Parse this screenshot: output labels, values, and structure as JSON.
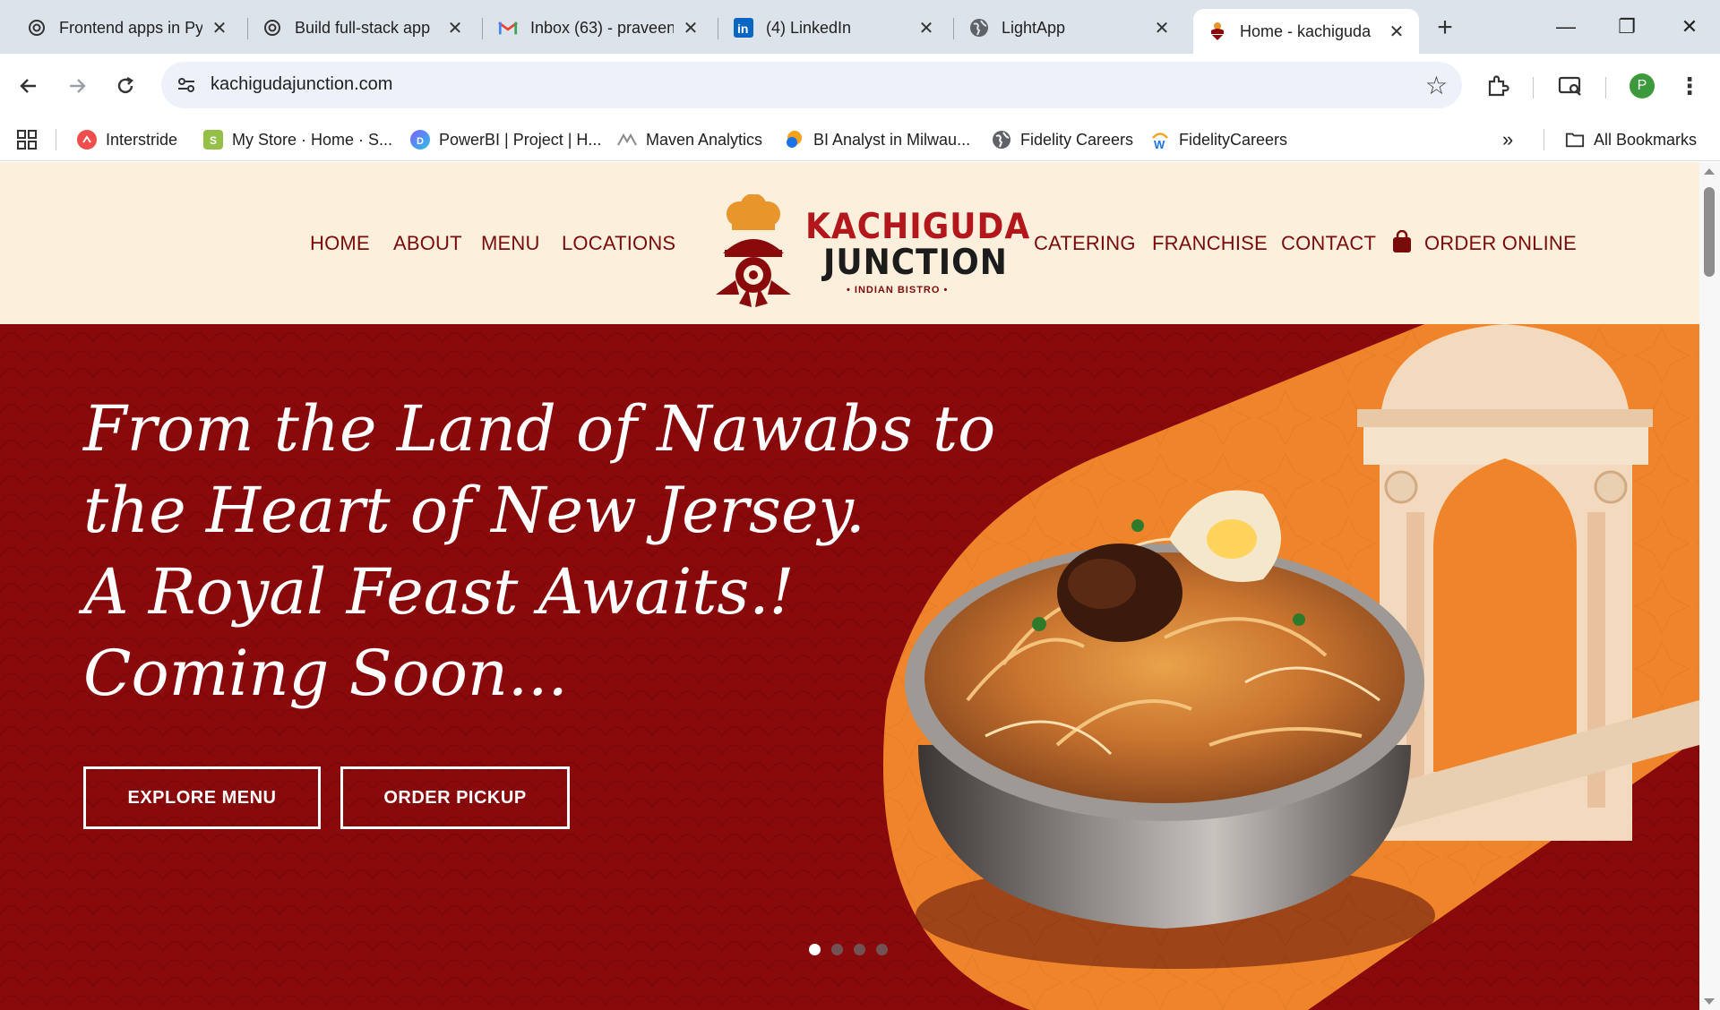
{
  "browser": {
    "tabs": [
      {
        "title": "Frontend apps in Py",
        "icon": "openai-icon",
        "active": false
      },
      {
        "title": "Build full-stack app",
        "icon": "openai-icon",
        "active": false
      },
      {
        "title": "Inbox (63) - praveen",
        "icon": "gmail-icon",
        "active": false
      },
      {
        "title": "(4) LinkedIn",
        "icon": "linkedin-icon",
        "active": false
      },
      {
        "title": "LightApp",
        "icon": "globe-icon",
        "active": false
      },
      {
        "title": "Home - kachiguda",
        "icon": "kachiguda-icon",
        "active": true
      }
    ],
    "new_tab": "+",
    "window_controls": {
      "minimize": "—",
      "restore": "❐",
      "close": "✕"
    },
    "url": "kachigudajunction.com",
    "profile_initial": "P",
    "bookmarks": [
      {
        "label": "Interstride",
        "icon": "interstride-icon",
        "color": "#f04d4d"
      },
      {
        "label": "My Store · Home · S...",
        "icon": "shopify-icon",
        "color": "#95bf47"
      },
      {
        "label": "PowerBI | Project | H...",
        "icon": "powerbi-icon",
        "color": "#7b61ff"
      },
      {
        "label": "Maven Analytics",
        "icon": "maven-icon",
        "color": "#888888"
      },
      {
        "label": "BI Analyst in Milwau...",
        "icon": "bi-icon",
        "color": "#f4a21a"
      },
      {
        "label": "Fidelity Careers",
        "icon": "globe-icon",
        "color": "#5f6368"
      },
      {
        "label": "FidelityCareers",
        "icon": "workday-icon",
        "color": "#f5a623"
      }
    ],
    "bookmarks_overflow": "»",
    "all_bookmarks": "All Bookmarks"
  },
  "site": {
    "nav_left": [
      "HOME",
      "ABOUT",
      "MENU",
      "LOCATIONS"
    ],
    "nav_right": [
      "CATERING",
      "FRANCHISE",
      "CONTACT",
      "ORDER ONLINE"
    ],
    "logo": {
      "line1": "KACHIGUDA",
      "line2": "JUNCTION",
      "line3": "• INDIAN BISTRO •"
    },
    "hero": {
      "lines": [
        "From the Land of Nawabs to",
        "the Heart of New Jersey.",
        "A Royal Feast Awaits.!",
        "Coming Soon..."
      ],
      "buttons": [
        "EXPLORE MENU",
        "ORDER PICKUP"
      ],
      "slide_count": 4,
      "active_slide": 1
    },
    "colors": {
      "header_bg": "#fcefdc",
      "brand_red": "#8a0a0c",
      "nav_text": "#7a0b0b",
      "accent_orange": "#f0842a"
    }
  }
}
